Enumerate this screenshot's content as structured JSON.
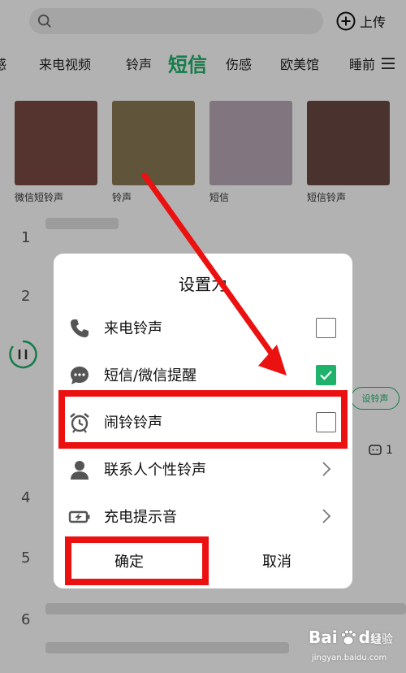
{
  "colors": {
    "accent": "#1fb26a",
    "highlight": "#ec1111"
  },
  "header": {
    "upload_label": "上传",
    "search_icon": "search-icon",
    "upload_icon": "plus-circle-icon"
  },
  "tabs": [
    "感",
    "来电视频",
    "铃声",
    "短信",
    "伤感",
    "欧美馆",
    "睡前"
  ],
  "active_tab": "短信",
  "thumbnails": [
    {
      "label": "微信短铃声",
      "color": "#7a4a44"
    },
    {
      "label": "铃声",
      "color": "#8a7a55"
    },
    {
      "label": "短信",
      "color": "#b9a8b6"
    },
    {
      "label": "短信铃声",
      "color": "#6b4a44"
    }
  ],
  "ranks": [
    "1",
    "2",
    "4",
    "5",
    "6"
  ],
  "set_ring_button": "设铃声",
  "comment_count": "1",
  "dialog": {
    "title": "设置为",
    "options": [
      {
        "label": "来电铃声",
        "icon": "phone-icon",
        "control": "checkbox",
        "checked": false
      },
      {
        "label": "短信/微信提醒",
        "icon": "chat-bubble-icon",
        "control": "checkbox",
        "checked": true
      },
      {
        "label": "闹铃铃声",
        "icon": "alarm-clock-icon",
        "control": "checkbox",
        "checked": false
      },
      {
        "label": "联系人个性铃声",
        "icon": "contact-person-icon",
        "control": "chevron"
      },
      {
        "label": "充电提示音",
        "icon": "battery-charging-icon",
        "control": "chevron"
      }
    ],
    "confirm_label": "确定",
    "cancel_label": "取消"
  },
  "watermark": {
    "brand": "Bai",
    "brand2": "du",
    "text": "经验",
    "url": "jingyan.baidu.com"
  }
}
